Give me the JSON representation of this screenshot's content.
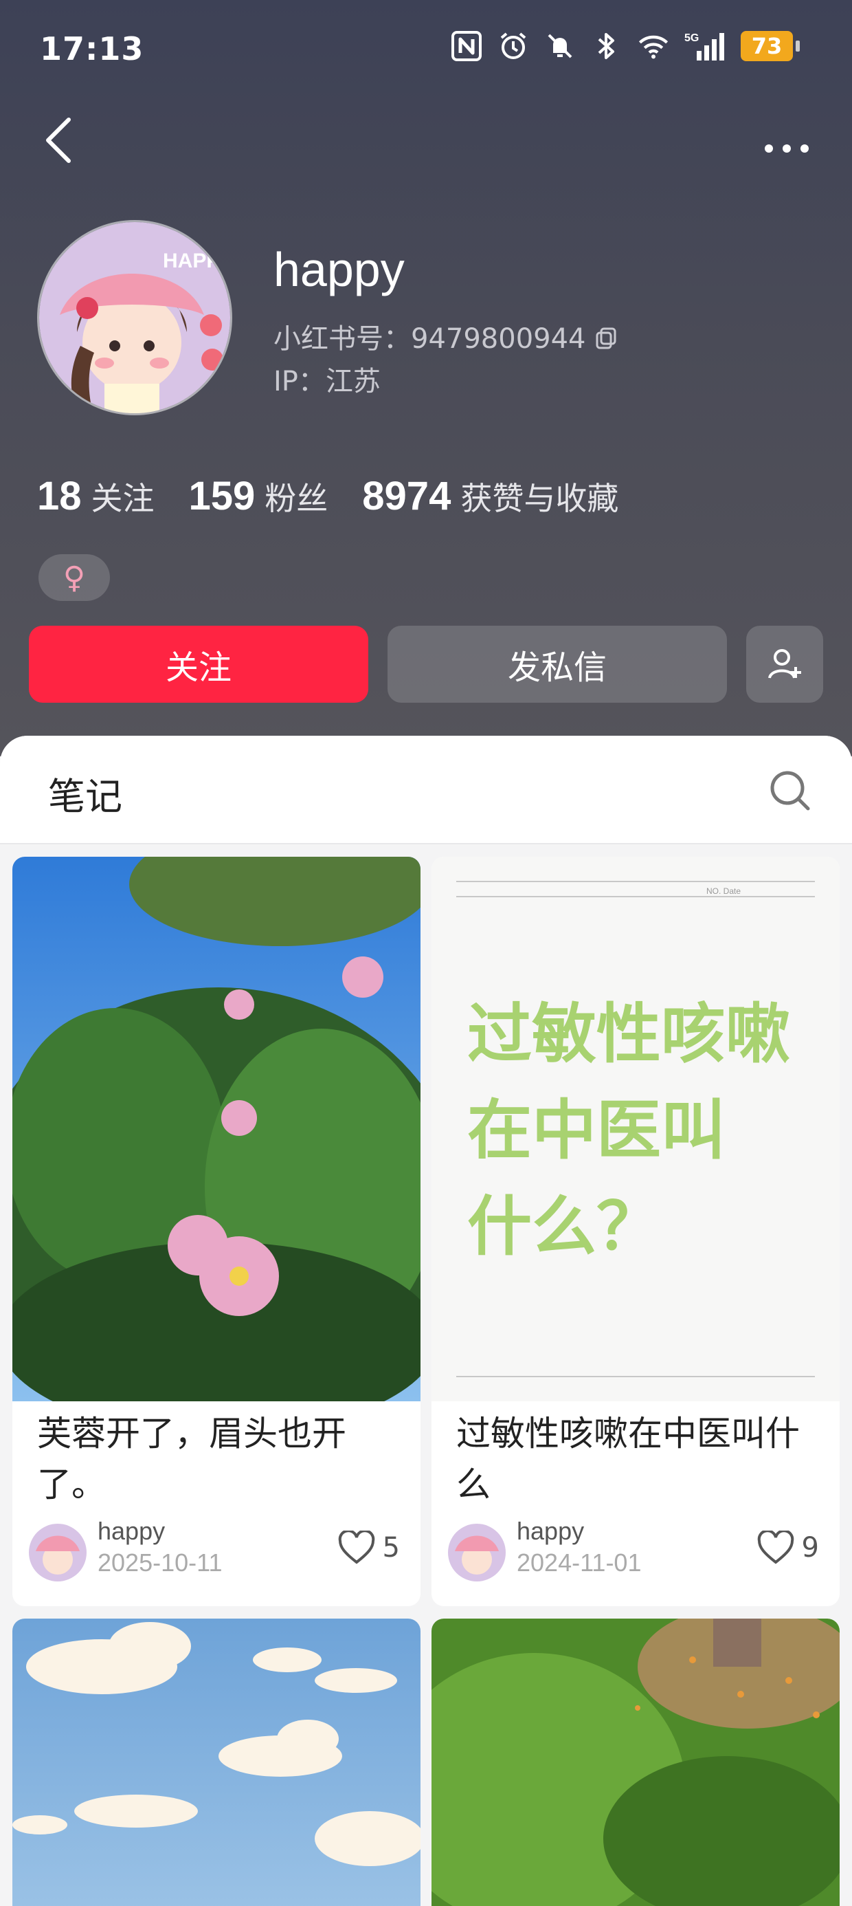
{
  "status_bar": {
    "time": "17:13",
    "battery": "73",
    "network": "5G"
  },
  "profile": {
    "username": "happy",
    "red_id": "小红书号：9479800944",
    "ip": "IP：江苏",
    "stats": [
      {
        "num": "18",
        "label": "关注"
      },
      {
        "num": "159",
        "label": "粉丝"
      },
      {
        "num": "8974",
        "label": "获赞与收藏"
      }
    ],
    "gender": "♀",
    "avatar_badge": "HAPPY"
  },
  "actions": {
    "follow": "关注",
    "message": "发私信"
  },
  "tabs": {
    "notes": "笔记"
  },
  "notes": [
    {
      "title": "芙蓉开了，眉头也开了。",
      "author": "happy",
      "date": "2025-10-11",
      "likes": "5"
    },
    {
      "title": "过敏性咳嗽在中医叫什么",
      "author": "happy",
      "date": "2024-11-01",
      "likes": "9",
      "cover_text": [
        "过敏性咳嗽",
        "在中医叫",
        "什么？"
      ],
      "cover_header": "NO.        Date"
    }
  ]
}
